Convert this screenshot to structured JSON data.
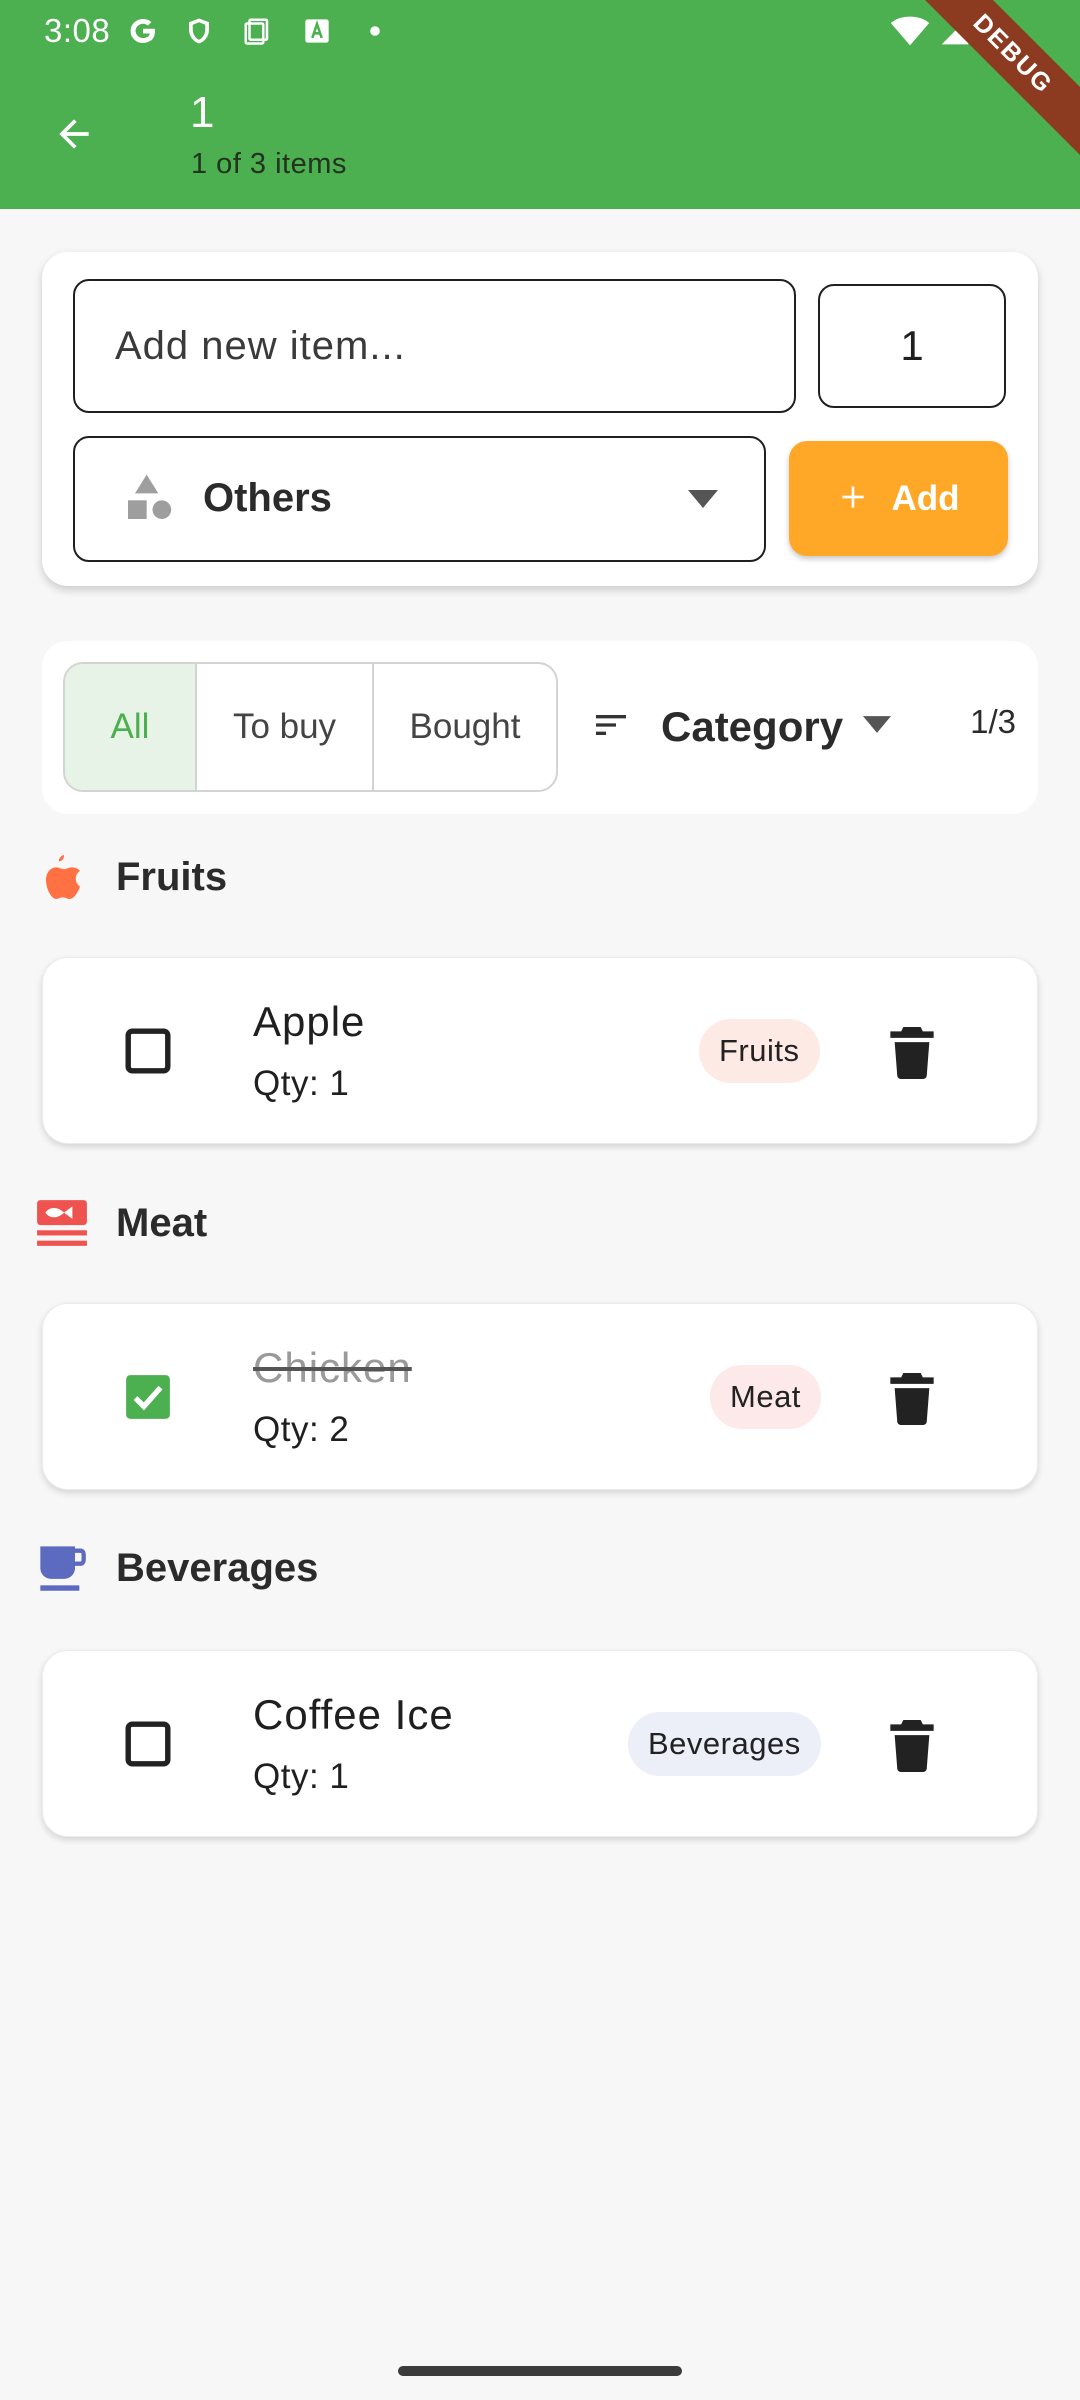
{
  "status_bar": {
    "time": "3:08",
    "icons": [
      "google-icon",
      "shield-icon",
      "clipboard-icon",
      "font-a-icon",
      "dot-icon",
      "wifi-icon",
      "signal-icon",
      "battery-icon"
    ]
  },
  "app_bar": {
    "title": "1",
    "subtitle": "1 of 3 items",
    "debug_banner": "DEBUG",
    "background_color": "#4caf50"
  },
  "add_form": {
    "name_placeholder": "Add new item...",
    "quantity_value": "1",
    "category_selected": "Others",
    "add_button_label": "Add",
    "add_button_color": "#ffa726"
  },
  "filters": {
    "segments": [
      "All",
      "To buy",
      "Bought"
    ],
    "selected_segment": "All",
    "sort_label": "Category",
    "counter": "1/3"
  },
  "groups": [
    {
      "title": "Fruits",
      "icon": "apple-icon",
      "icon_color": "#ff7043",
      "items": [
        {
          "name": "Apple",
          "qty": "Qty: 1",
          "chip": "Fruits",
          "chip_color": "#fdeae4",
          "checked": false
        }
      ]
    },
    {
      "title": "Meat",
      "icon": "meat-icon",
      "icon_color": "#ef5350",
      "items": [
        {
          "name": "Chicken",
          "qty": "Qty: 2",
          "chip": "Meat",
          "chip_color": "#fde9e9",
          "checked": true
        }
      ]
    },
    {
      "title": "Beverages",
      "icon": "cup-icon",
      "icon_color": "#5c6bc0",
      "items": [
        {
          "name": "Coffee Ice",
          "qty": "Qty: 1",
          "chip": "Beverages",
          "chip_color": "#eceef8",
          "checked": false
        }
      ]
    }
  ]
}
